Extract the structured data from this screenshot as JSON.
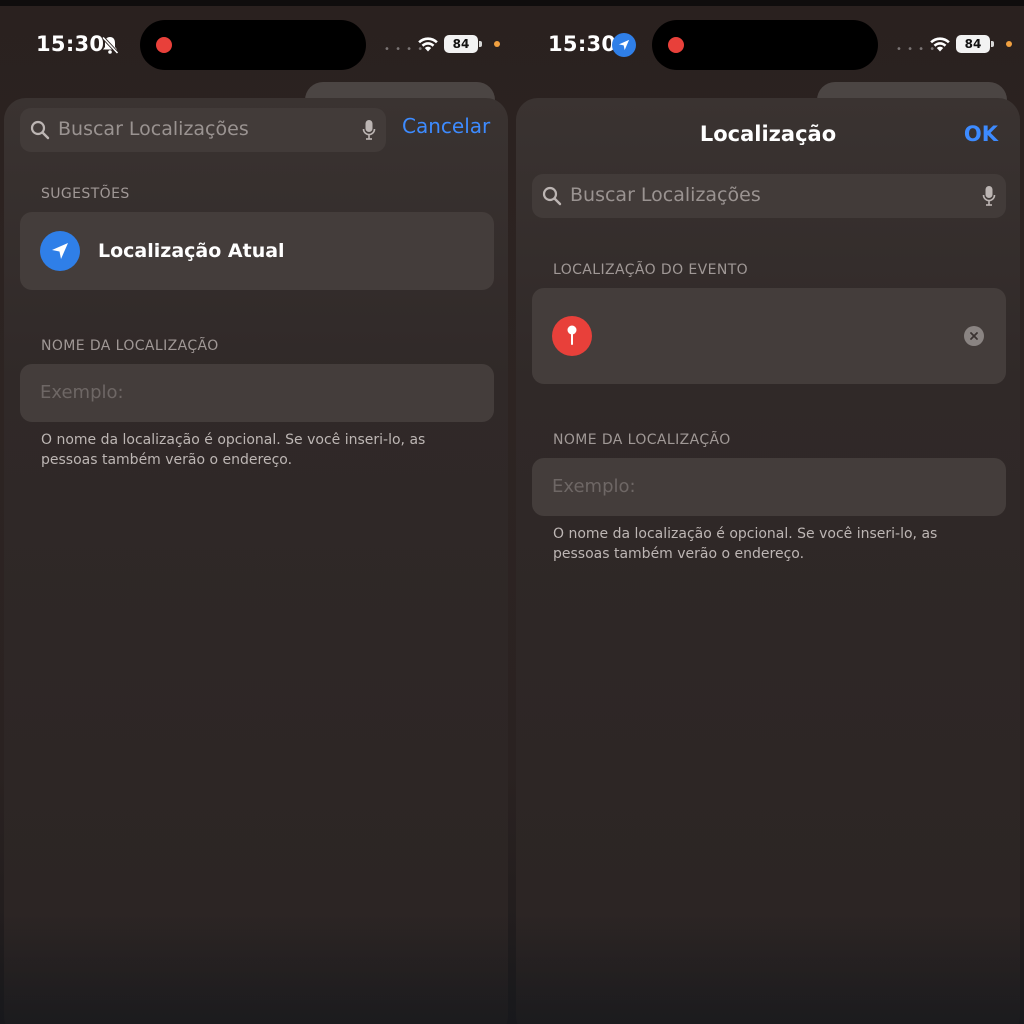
{
  "left_screen": {
    "status_bar": {
      "time": "15:30",
      "battery": "84"
    },
    "search": {
      "placeholder": "Buscar Localizações",
      "cancel_label": "Cancelar"
    },
    "suggestions": {
      "header": "SUGESTÕES",
      "items": [
        {
          "label": "Localização Atual",
          "icon": "location-arrow-icon"
        }
      ]
    },
    "location_name": {
      "header": "NOME DA LOCALIZAÇÃO",
      "placeholder": "Exemplo:",
      "footnote_line1": "O nome da localização é opcional. Se você inseri-lo, as",
      "footnote_line2": "pessoas também verão o endereço."
    }
  },
  "right_screen": {
    "status_bar": {
      "time": "15:30",
      "battery": "84"
    },
    "title": "Localização",
    "ok_label": "OK",
    "search": {
      "placeholder": "Buscar Localizações"
    },
    "event_location": {
      "header": "LOCALIZAÇÃO DO EVENTO",
      "value": "",
      "icon": "map-pin-icon"
    },
    "location_name": {
      "header": "NOME DA LOCALIZAÇÃO",
      "placeholder": "Exemplo:",
      "footnote_line1": "O nome da localização é opcional. Se você inseri-lo, as",
      "footnote_line2": "pessoas também verão o endereço."
    }
  },
  "colors": {
    "accent_blue": "#3d8bff",
    "recording_red": "#e8403a",
    "pin_red": "#e8403a",
    "location_blue": "#2f7fe8"
  }
}
